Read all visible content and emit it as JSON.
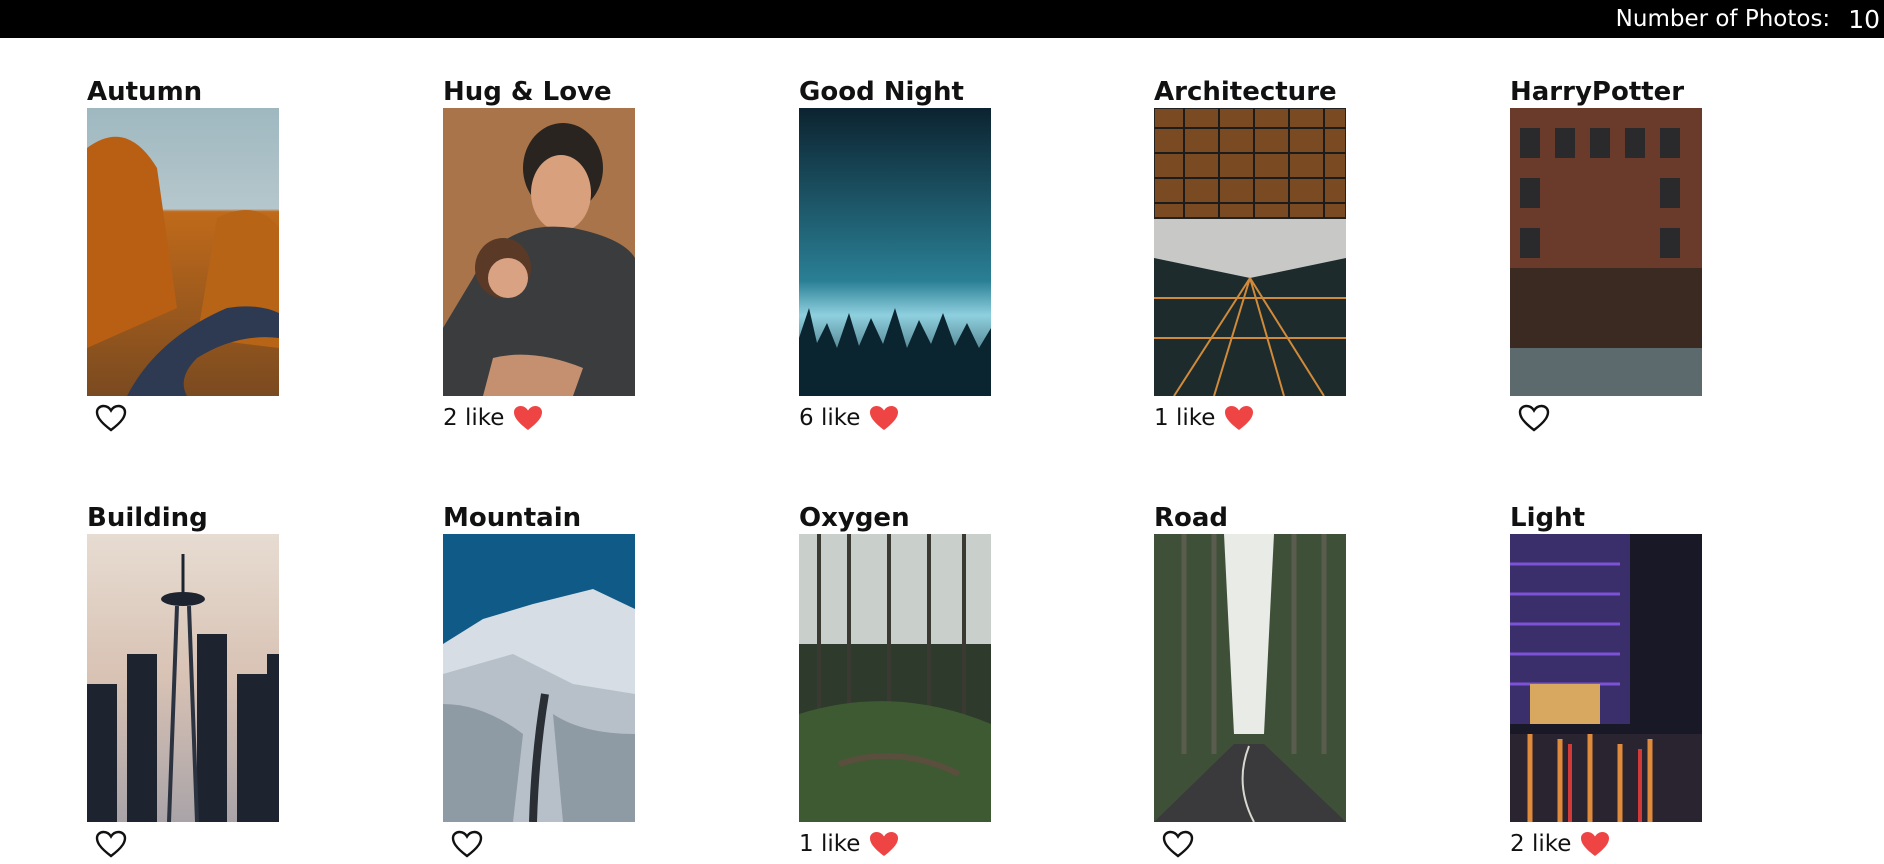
{
  "header": {
    "label": "Number of Photos:",
    "count": "10"
  },
  "photos": [
    {
      "title": "Autumn",
      "likes": "",
      "liked": false
    },
    {
      "title": "Hug & Love",
      "likes": "2 like",
      "liked": true
    },
    {
      "title": "Good Night",
      "likes": "6 like",
      "liked": true
    },
    {
      "title": "Architecture",
      "likes": "1 like",
      "liked": true
    },
    {
      "title": "HarryPotter",
      "likes": "",
      "liked": false
    },
    {
      "title": "Building",
      "likes": "",
      "liked": false
    },
    {
      "title": "Mountain",
      "likes": "",
      "liked": false
    },
    {
      "title": "Oxygen",
      "likes": "1 like",
      "liked": true
    },
    {
      "title": "Road",
      "likes": "",
      "liked": false
    },
    {
      "title": "Light",
      "likes": "2 like",
      "liked": true
    }
  ],
  "colors": {
    "heart_filled": "#ef4444",
    "heart_outline": "#111111",
    "topbar": "#000000"
  },
  "icons": {
    "liked": "heart-filled-icon",
    "unliked": "heart-outline-icon"
  }
}
